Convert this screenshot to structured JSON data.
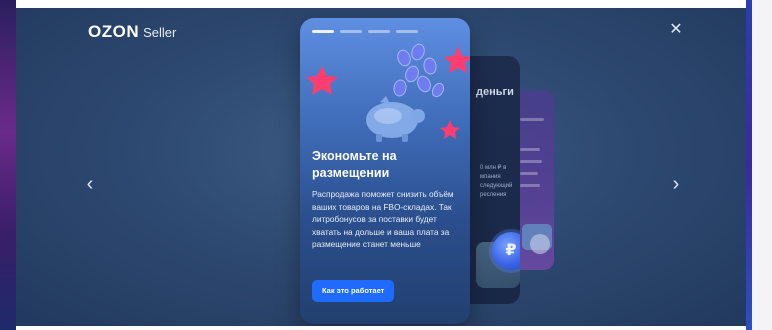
{
  "header": {
    "brand": "OZON",
    "product": "Seller",
    "close_glyph": "✕"
  },
  "navigation": {
    "prev_glyph": "‹",
    "next_glyph": "›"
  },
  "slides": {
    "current": {
      "title": "Экономьте на размещении",
      "body": "Распродажа поможет снизить объём ваших товаров на FBO-складах. Так литробонусов за поставки будет хватать на дольше и ваша плата за размещение станет меньше",
      "button_label": "Как это работает",
      "progress_total": 4,
      "progress_active": 1
    },
    "next_preview": {
      "title": "деньги",
      "snippet": "0 млн ₽ в мпания следующий ресления",
      "coin_glyph": "₽",
      "plus_glyph": "+"
    }
  },
  "colors": {
    "overlay": "#2e4a72",
    "card_top": "#5f8fe2",
    "card_bottom": "#22406f",
    "cta": "#1f6bff",
    "star": "#ff3d6e"
  },
  "icons": [
    "close-icon",
    "chevron-left-icon",
    "chevron-right-icon",
    "piggy-bank-icon",
    "coin-icon",
    "star-icon"
  ]
}
